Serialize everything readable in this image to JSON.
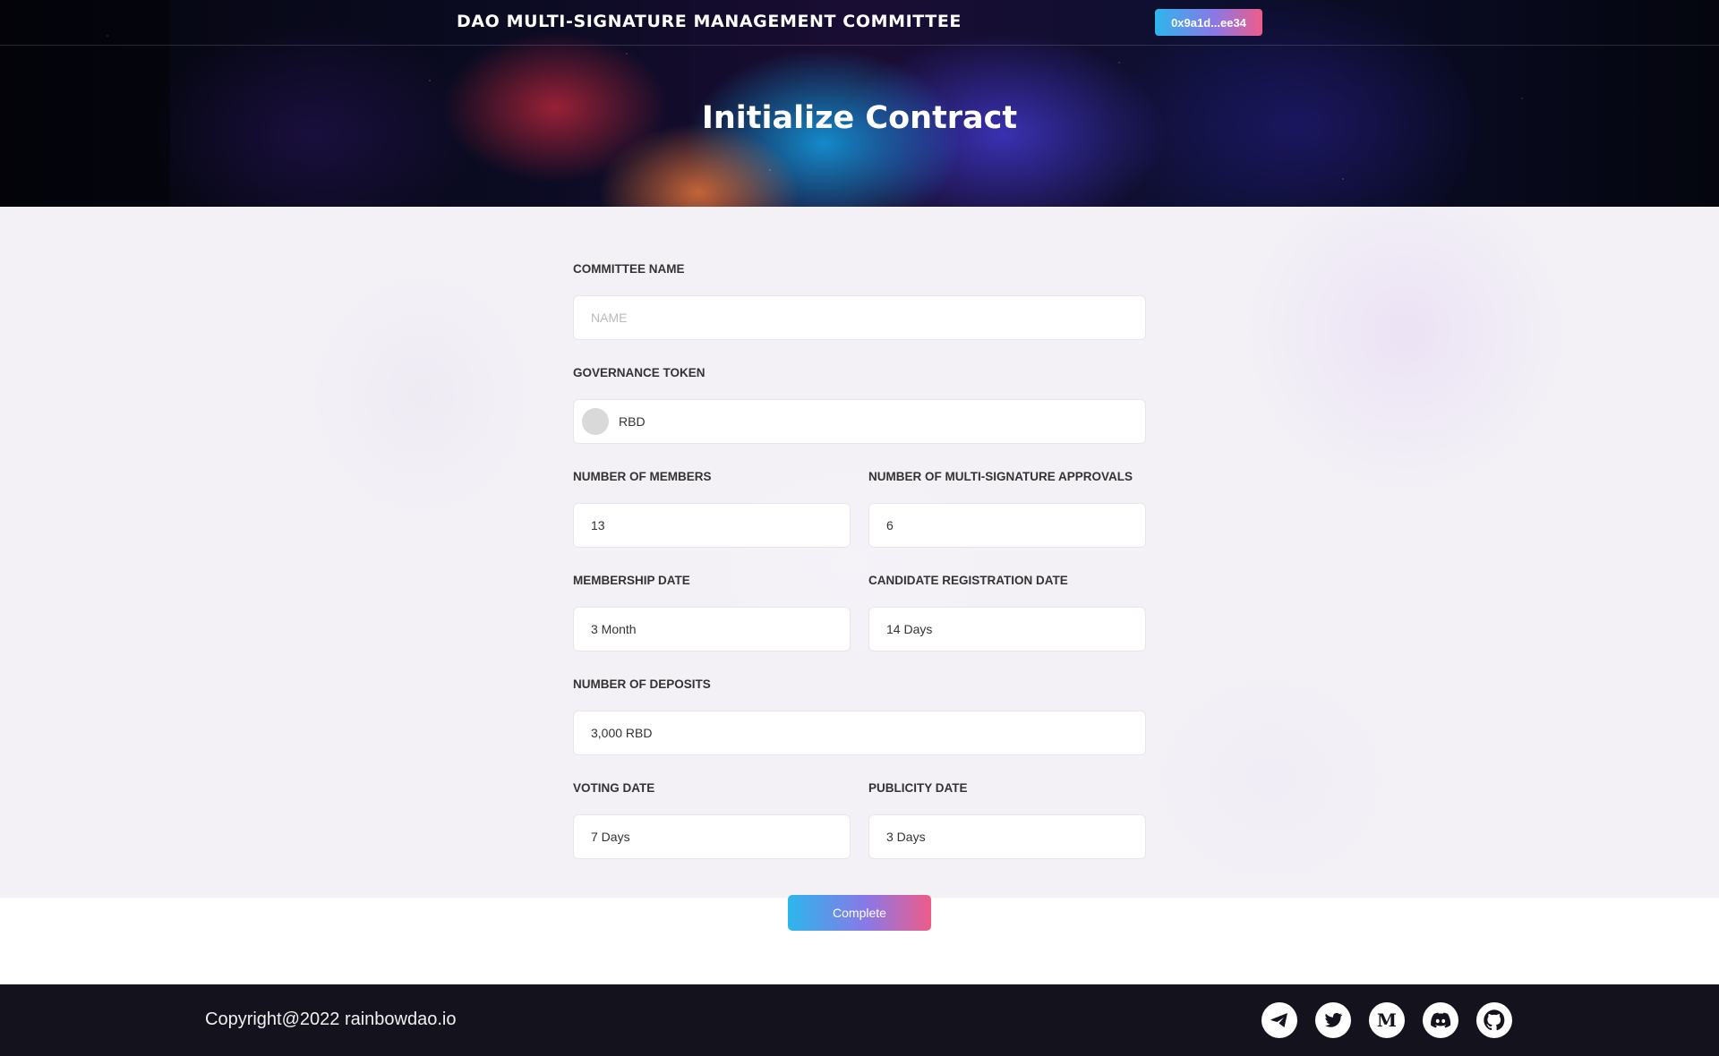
{
  "header": {
    "site_title": "DAO MULTI-SIGNATURE MANAGEMENT COMMITTEE",
    "wallet_address": "0x9a1d...ee34",
    "page_title": "Initialize Contract"
  },
  "form": {
    "committee_name": {
      "label": "COMMITTEE NAME",
      "value": "",
      "placeholder": "NAME"
    },
    "governance_token": {
      "label": "GOVERNANCE TOKEN",
      "value": "RBD"
    },
    "number_of_members": {
      "label": "NUMBER OF MEMBERS",
      "value": "13"
    },
    "multisig_approvals": {
      "label": "NUMBER OF MULTI-SIGNATURE APPROVALS",
      "value": "6"
    },
    "membership_date": {
      "label": "MEMBERSHIP DATE",
      "value": "3 Month"
    },
    "candidate_registration_date": {
      "label": "CANDIDATE REGISTRATION DATE",
      "value": "14 Days"
    },
    "number_of_deposits": {
      "label": "NUMBER OF DEPOSITS",
      "value": "3,000 RBD"
    },
    "voting_date": {
      "label": "VOTING DATE",
      "value": "7 Days"
    },
    "publicity_date": {
      "label": "PUBLICITY DATE",
      "value": "3 Days"
    },
    "complete_label": "Complete"
  },
  "footer": {
    "copyright": "Copyright@2022 rainbowdao.io",
    "social_icons": [
      "telegram-icon",
      "twitter-icon",
      "medium-icon",
      "discord-icon",
      "github-icon"
    ]
  },
  "colors": {
    "accent_gradient_start": "#2cb6ec",
    "accent_gradient_end": "#ee5c8a",
    "footer_bg": "#13121d",
    "form_bg": "#f3f1f6"
  }
}
